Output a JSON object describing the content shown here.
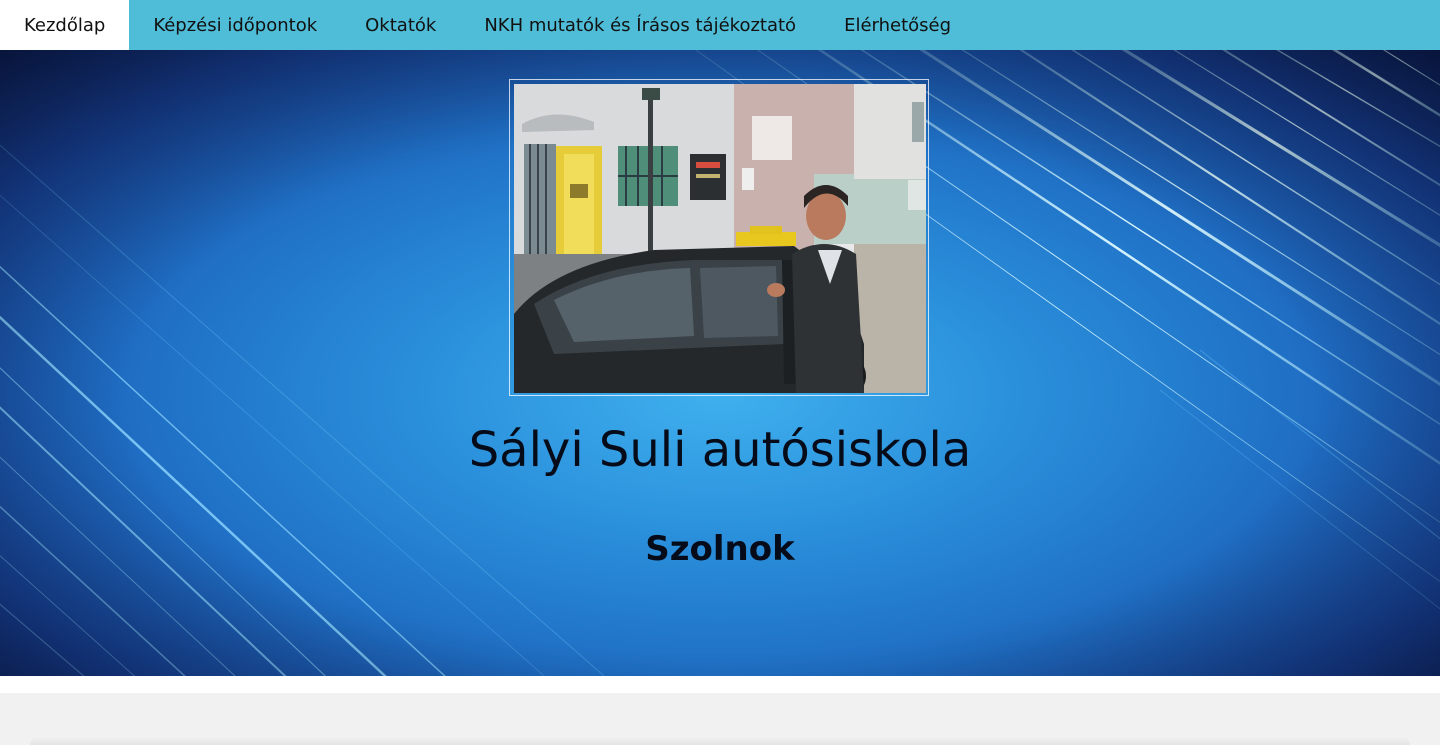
{
  "nav": {
    "items": [
      {
        "label": "Kezdőlap",
        "active": true
      },
      {
        "label": "Képzési időpontok",
        "active": false
      },
      {
        "label": "Oktatók",
        "active": false
      },
      {
        "label": "NKH mutatók és Írásos tájékoztató",
        "active": false
      },
      {
        "label": "Elérhetőség",
        "active": false
      }
    ]
  },
  "hero": {
    "title": "Sályi Suli autósiskola",
    "subtitle": "Szolnok"
  },
  "colors": {
    "nav_background": "#4fbdd7",
    "active_tab": "#ffffff",
    "hero_center": "#3fb0ee",
    "hero_edge": "#0e1f52",
    "text": "#050b18"
  }
}
